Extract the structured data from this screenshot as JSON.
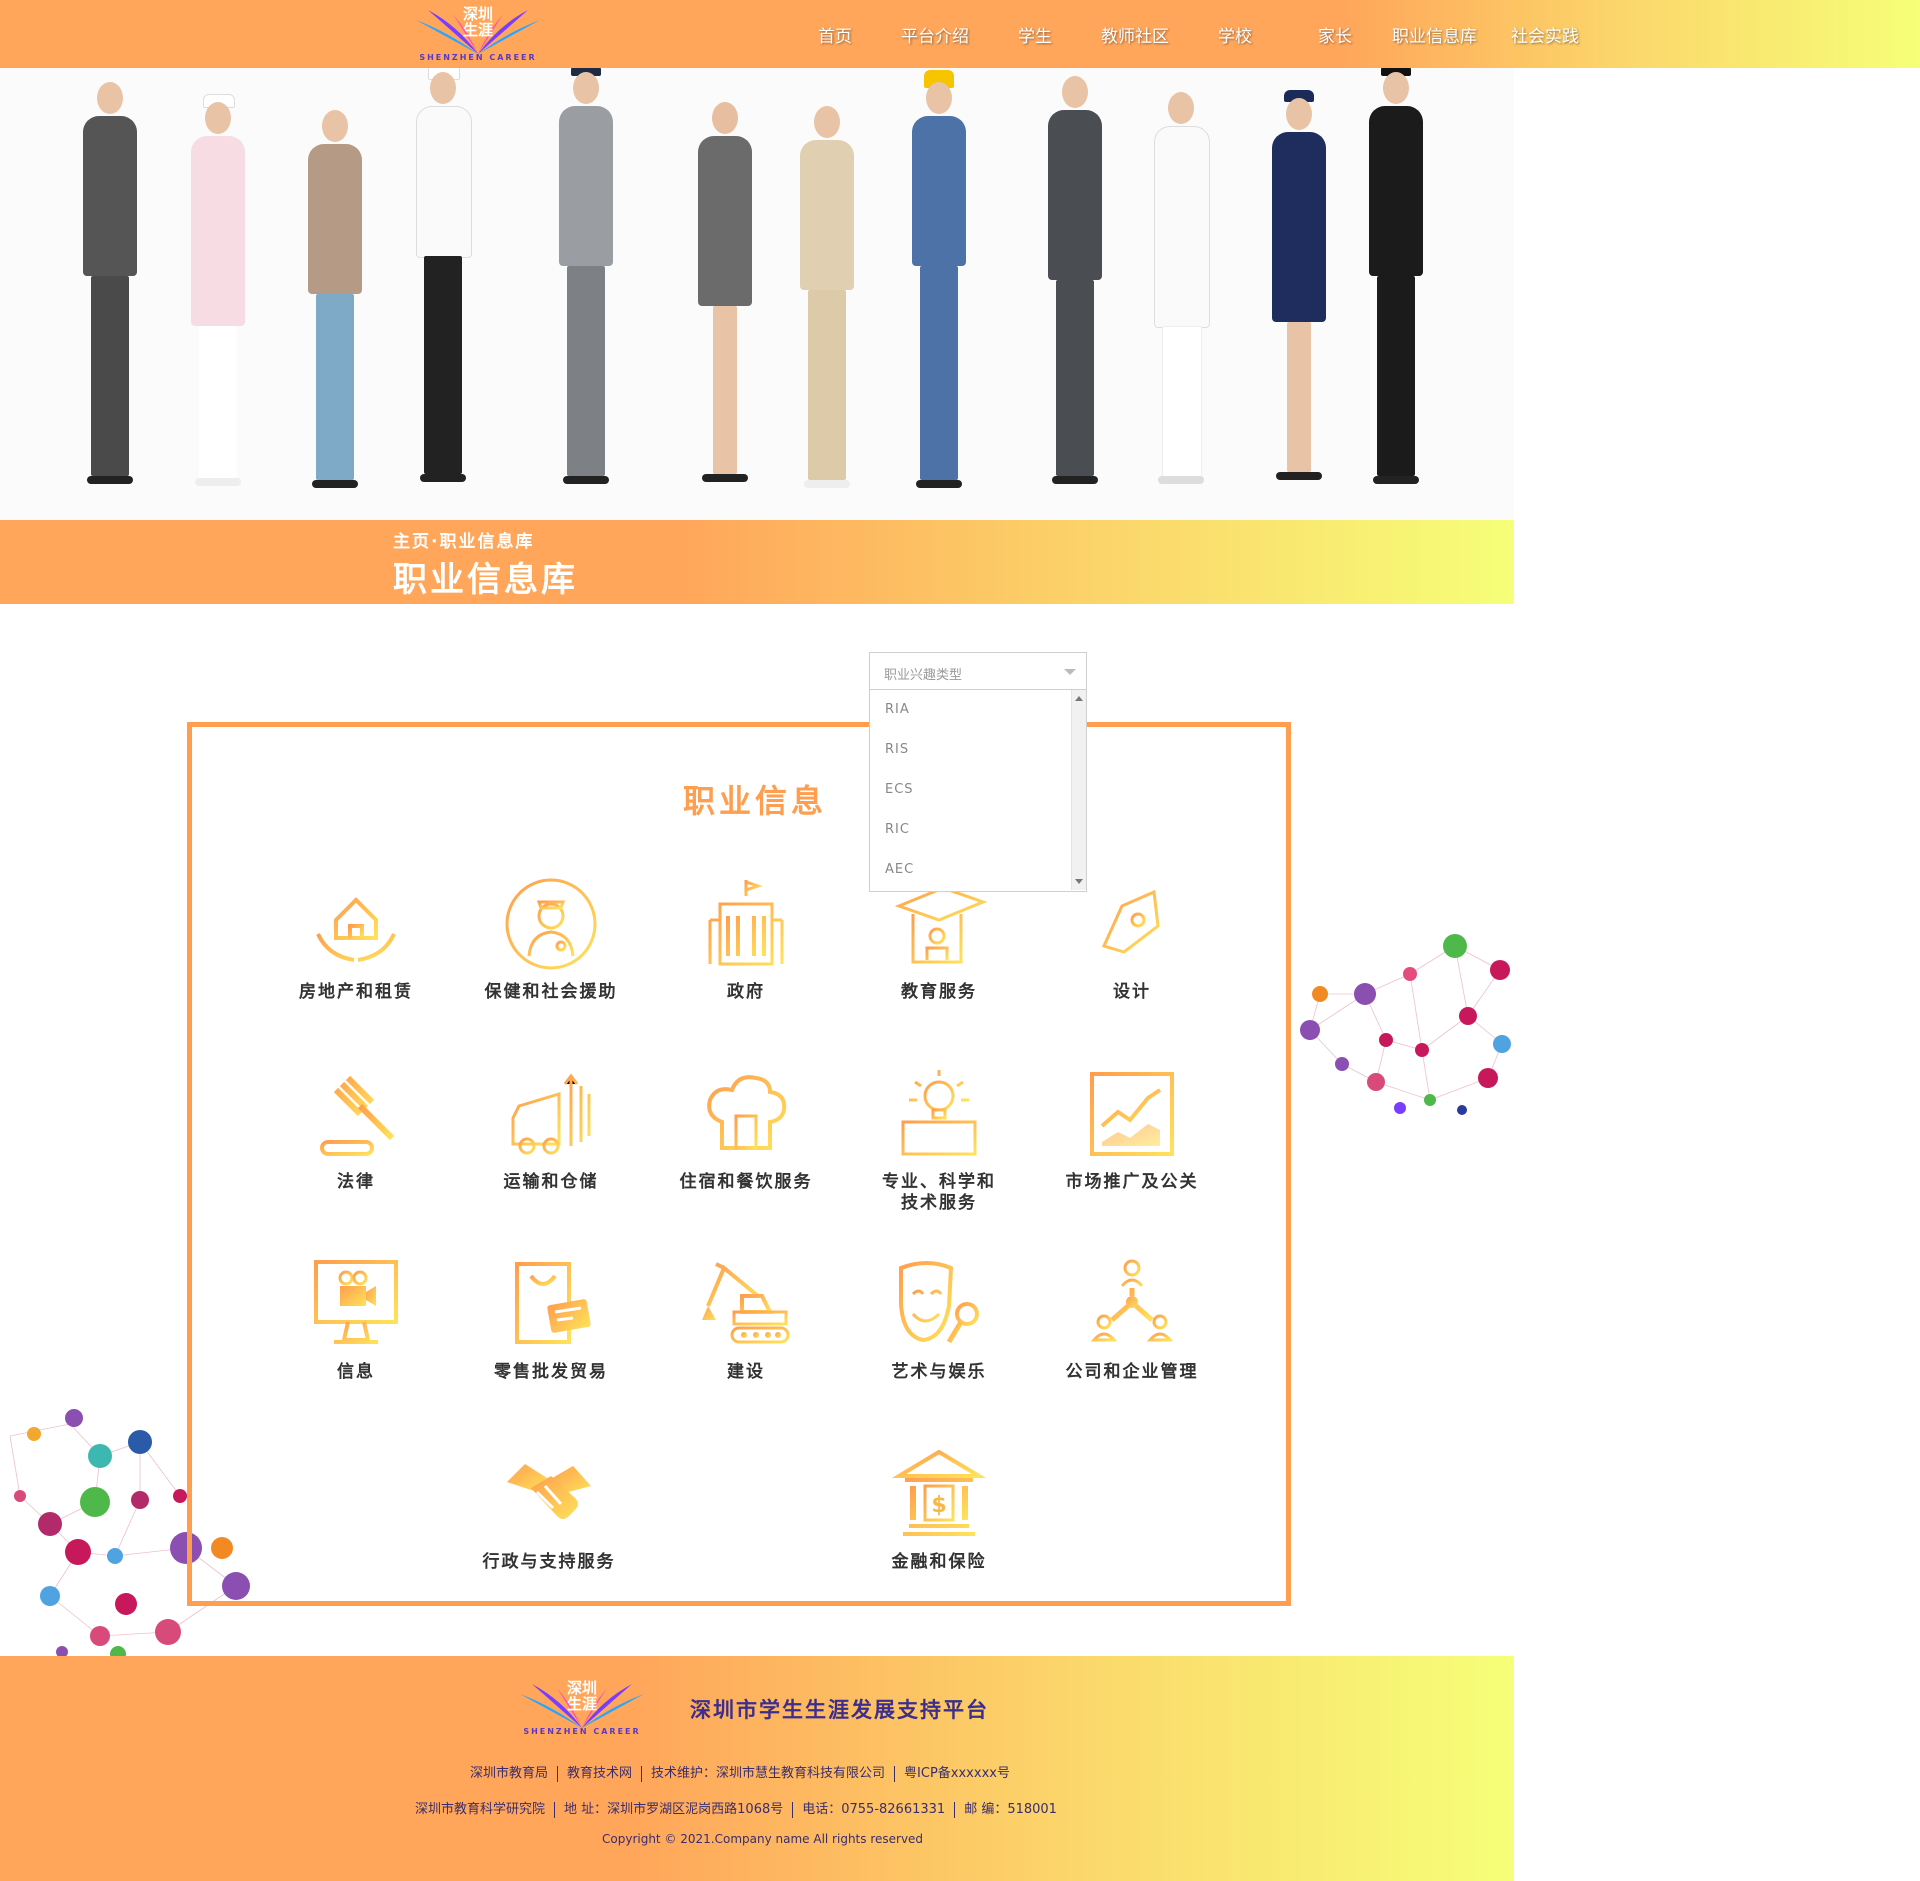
{
  "colors": {
    "brand_orange": "#ffa65a",
    "brand_yellow": "#f6ff78",
    "footer_text": "#3a2d6c"
  },
  "header": {
    "logo_text_line1": "深圳",
    "logo_text_line2": "生涯",
    "logo_sub": "SHENZHEN CAREER",
    "nav": [
      {
        "label": "首页"
      },
      {
        "label": "平台介绍"
      },
      {
        "label": "学生"
      },
      {
        "label": "教师社区"
      },
      {
        "label": "学校"
      },
      {
        "label": "家长"
      },
      {
        "label": "职业信息库"
      },
      {
        "label": "社会实践"
      }
    ]
  },
  "banner": {
    "breadcrumb": "主页·职业信息库",
    "title": "职业信息库"
  },
  "filter": {
    "placeholder": "职业兴趣类型",
    "options": [
      "RIA",
      "RIS",
      "ECS",
      "RIC",
      "AEC"
    ]
  },
  "main": {
    "section_title": "职业信息",
    "categories": [
      {
        "label": "房地产和租赁",
        "icon": "house-hands-icon"
      },
      {
        "label": "保健和社会援助",
        "icon": "doctor-icon"
      },
      {
        "label": "政府",
        "icon": "government-building-icon"
      },
      {
        "label": "教育服务",
        "icon": "graduation-cap-icon"
      },
      {
        "label": "设计",
        "icon": "pen-nib-icon"
      },
      {
        "label": "法律",
        "icon": "gavel-icon"
      },
      {
        "label": "运输和仓储",
        "icon": "truck-icon"
      },
      {
        "label": "住宿和餐饮服务",
        "icon": "chef-hat-icon"
      },
      {
        "label": "专业、科学和",
        "label2": "技术服务",
        "icon": "lightbulb-icon"
      },
      {
        "label": "市场推广及公关",
        "icon": "trend-chart-icon"
      },
      {
        "label": "信息",
        "icon": "monitor-camera-icon"
      },
      {
        "label": "零售批发贸易",
        "icon": "shopping-bag-card-icon"
      },
      {
        "label": "建设",
        "icon": "excavator-icon"
      },
      {
        "label": "艺术与娱乐",
        "icon": "theater-masks-icon"
      },
      {
        "label": "公司和企业管理",
        "icon": "org-people-icon"
      },
      {
        "label": "行政与支持服务",
        "icon": "handshake-icon"
      },
      {
        "label": "金融和保险",
        "icon": "bank-icon"
      }
    ]
  },
  "footer": {
    "title": "深圳市学生生涯发展支持平台",
    "line1": [
      "深圳市教育局",
      "教育技术网",
      "技术维护：深圳市慧生教育科技有限公司",
      "粤ICP备xxxxxx号"
    ],
    "line2": [
      "深圳市教育科学研究院",
      "地  址：深圳市罗湖区泥岗西路1068号",
      "电话：0755-82661331",
      "邮  编：518001"
    ],
    "copyright": "Copyright © 2021.Company name All rights reserved"
  }
}
